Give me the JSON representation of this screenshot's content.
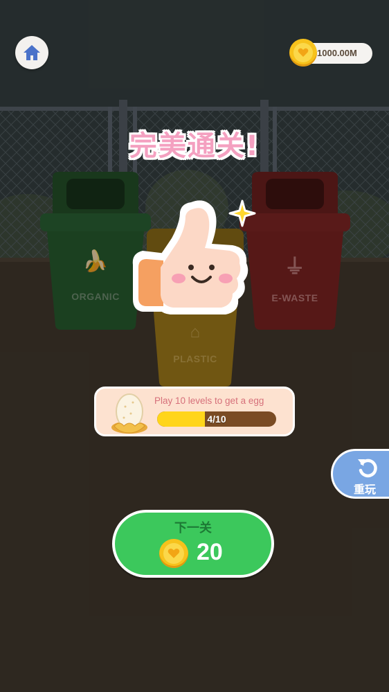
{
  "header": {
    "home_icon": "home-icon",
    "coins": "1000.00M"
  },
  "bins": [
    {
      "label": "ORGANIC",
      "icon": "banana-peel-icon",
      "color": "#1f5a2a"
    },
    {
      "label": "PLASTIC",
      "icon": "bottle-icon",
      "color": "#b8860b"
    },
    {
      "label": "E-WASTE",
      "icon": "plug-icon",
      "color": "#7a1c1c"
    }
  ],
  "result": {
    "title": "完美通关!"
  },
  "egg_reward": {
    "text": "Play 10 levels to get a egg",
    "progress_label": "4/10",
    "progress_fraction": 0.4
  },
  "replay": {
    "label": "重玩",
    "icon": "replay-icon"
  },
  "next_level": {
    "label": "下一关",
    "cost": "20"
  },
  "colors": {
    "title_pink": "#f4a0c0",
    "next_green": "#3cc85c",
    "replay_blue": "#79a6e3",
    "progress_yellow": "#ffd51a"
  }
}
